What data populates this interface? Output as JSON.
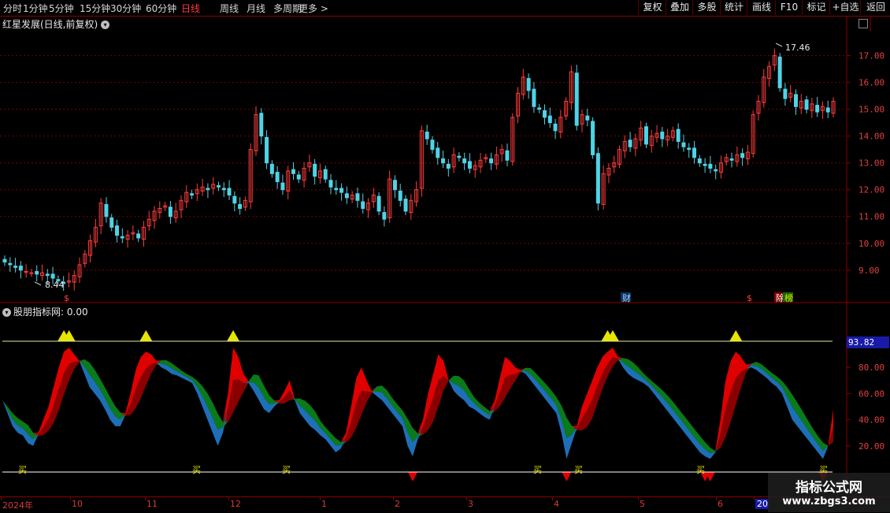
{
  "toolbar": {
    "periods": [
      "分时",
      "1分钟",
      "5分钟",
      "15分钟",
      "30分钟",
      "60分钟",
      "日线",
      "周线",
      "月线",
      "多周期",
      "更多 >"
    ],
    "active_period": "日线",
    "right_buttons": [
      "复权",
      "叠加",
      "多股",
      "统计",
      "画线",
      "F10",
      "标记",
      "+自选",
      "返回"
    ]
  },
  "main_chart": {
    "title": "红星发展(日线,前复权)",
    "high_label": "17.46",
    "low_label": "8.44",
    "y_ticks": [
      "17.00",
      "16.00",
      "15.00",
      "14.00",
      "13.00",
      "12.00",
      "11.00",
      "10.00",
      "9.00"
    ],
    "markers": [
      "$",
      "财",
      "$",
      "除",
      "榜"
    ]
  },
  "indicator": {
    "title": "股朋指标网",
    "value_text": ": 0.00",
    "current_value": "93.82",
    "y_ticks": [
      "80.00",
      "60.00",
      "40.00",
      "20.00"
    ],
    "buy_label": "买"
  },
  "x_axis": {
    "labels": [
      "2024年",
      "10",
      "11",
      "12",
      "1",
      "2",
      "3",
      "4",
      "5",
      "6",
      "20"
    ]
  },
  "watermark": {
    "title": "指标公式网",
    "url": "www.zbgs3.com"
  },
  "colors": {
    "up": "#ff3b3b",
    "down": "#4fd3e6",
    "red_fill": "#e00000",
    "dark_red": "#8a0000",
    "green_fill": "#0a7a1a",
    "blue_fill": "#1e6fb8",
    "yellow": "#e6e600"
  },
  "chart_data": {
    "type": "candlestick",
    "price_range": [
      8.2,
      17.9
    ],
    "high": 17.46,
    "low": 8.44,
    "closes": [
      9.3,
      9.2,
      9.1,
      9.0,
      8.95,
      8.9,
      8.85,
      8.9,
      8.8,
      8.7,
      8.6,
      8.5,
      8.6,
      8.8,
      9.2,
      9.6,
      10.1,
      10.6,
      11.5,
      11.0,
      10.6,
      10.3,
      10.2,
      10.3,
      10.4,
      10.2,
      10.6,
      10.9,
      11.2,
      11.3,
      11.4,
      11.0,
      11.2,
      11.6,
      11.9,
      11.8,
      12.0,
      12.1,
      12.0,
      12.2,
      12.1,
      12.0,
      11.8,
      11.5,
      11.3,
      11.6,
      13.5,
      14.8,
      14.0,
      13.0,
      12.6,
      12.3,
      12.0,
      12.7,
      12.6,
      12.4,
      12.8,
      13.0,
      12.5,
      12.7,
      12.4,
      12.1,
      12.0,
      11.9,
      11.7,
      11.8,
      11.6,
      11.3,
      11.5,
      11.8,
      11.2,
      10.9,
      12.4,
      12.0,
      11.6,
      11.2,
      11.6,
      12.0,
      14.2,
      13.9,
      13.5,
      13.2,
      13.0,
      12.8,
      13.3,
      13.2,
      13.0,
      12.8,
      12.9,
      13.1,
      13.2,
      13.0,
      13.3,
      13.5,
      13.1,
      14.7,
      15.6,
      16.2,
      15.7,
      15.1,
      15.0,
      14.7,
      14.5,
      14.2,
      14.7,
      15.3,
      16.4,
      14.4,
      14.8,
      14.6,
      13.3,
      11.5,
      12.6,
      12.8,
      13.0,
      13.5,
      13.8,
      13.6,
      13.9,
      14.3,
      13.7,
      14.0,
      14.1,
      13.9,
      14.0,
      14.2,
      13.8,
      13.6,
      13.5,
      13.2,
      13.0,
      12.9,
      12.8,
      12.7,
      13.0,
      13.2,
      13.1,
      13.3,
      13.2,
      13.4,
      14.8,
      15.3,
      16.2,
      16.6,
      17.0,
      15.8,
      15.4,
      15.6,
      15.1,
      15.3,
      15.0,
      15.2,
      14.9,
      15.1,
      14.9,
      15.3
    ]
  },
  "indicator_data": {
    "type": "area",
    "range": [
      0,
      100
    ],
    "upper_line": 100,
    "lower_line": 0,
    "values": [
      55,
      45,
      35,
      30,
      28,
      22,
      20,
      30,
      40,
      50,
      65,
      80,
      92,
      95,
      90,
      85,
      75,
      65,
      60,
      55,
      48,
      40,
      35,
      35,
      45,
      60,
      78,
      88,
      92,
      90,
      85,
      80,
      78,
      75,
      74,
      72,
      70,
      68,
      60,
      50,
      40,
      30,
      20,
      30,
      60,
      95,
      88,
      75,
      68,
      62,
      55,
      48,
      45,
      50,
      55,
      62,
      70,
      55,
      45,
      40,
      35,
      32,
      28,
      25,
      20,
      15,
      18,
      30,
      50,
      72,
      80,
      70,
      62,
      58,
      55,
      50,
      45,
      40,
      35,
      20,
      12,
      25,
      40,
      60,
      75,
      90,
      85,
      70,
      62,
      58,
      55,
      50,
      48,
      45,
      42,
      40,
      55,
      72,
      88,
      85,
      80,
      78,
      75,
      70,
      65,
      60,
      55,
      50,
      45,
      30,
      10,
      22,
      35,
      50,
      60,
      70,
      80,
      88,
      92,
      95,
      88,
      80,
      75,
      72,
      70,
      68,
      65,
      60,
      55,
      50,
      45,
      40,
      35,
      30,
      25,
      20,
      15,
      12,
      10,
      15,
      40,
      70,
      85,
      92,
      88,
      82,
      80,
      78,
      75,
      72,
      68,
      65,
      60,
      50,
      40,
      35,
      30,
      25,
      20,
      15,
      10,
      20,
      48
    ]
  }
}
